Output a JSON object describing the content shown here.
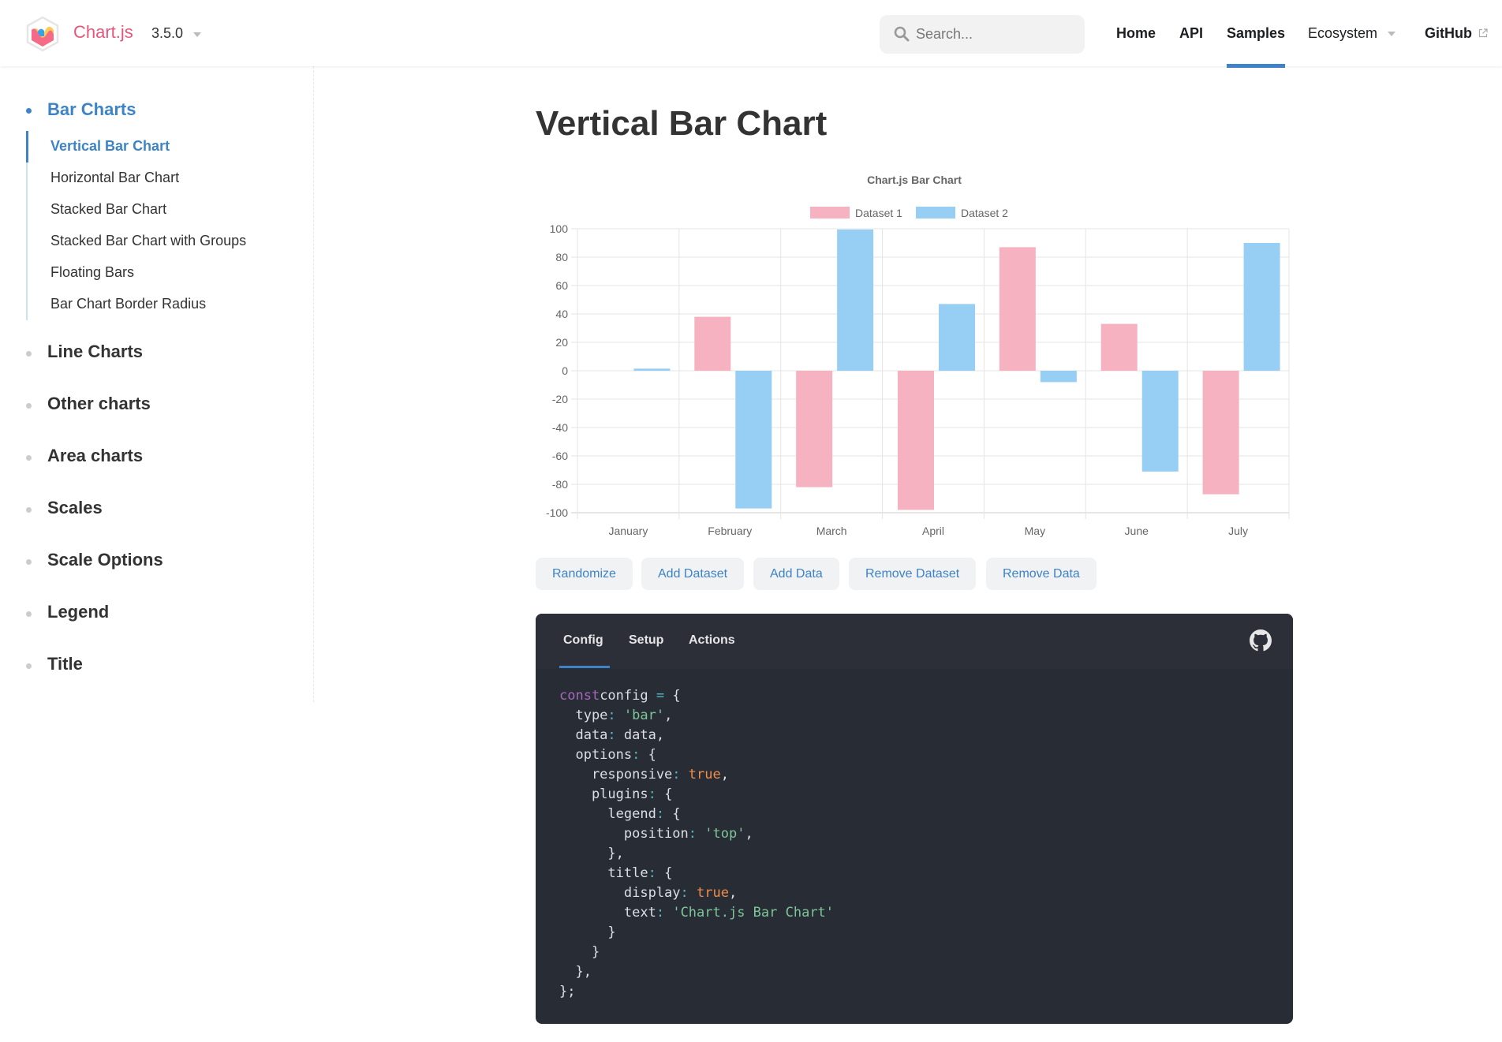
{
  "navbar": {
    "brand": "Chart.js",
    "version": "3.5.0",
    "search_placeholder": "Search...",
    "links": [
      "Home",
      "API",
      "Samples",
      "Ecosystem",
      "GitHub"
    ],
    "active_link": "Samples"
  },
  "sidebar": {
    "sections": [
      {
        "label": "Bar Charts",
        "active": true,
        "items": [
          {
            "label": "Vertical Bar Chart",
            "active": true
          },
          {
            "label": "Horizontal Bar Chart"
          },
          {
            "label": "Stacked Bar Chart"
          },
          {
            "label": "Stacked Bar Chart with Groups"
          },
          {
            "label": "Floating Bars"
          },
          {
            "label": "Bar Chart Border Radius"
          }
        ]
      },
      {
        "label": "Line Charts"
      },
      {
        "label": "Other charts"
      },
      {
        "label": "Area charts"
      },
      {
        "label": "Scales"
      },
      {
        "label": "Scale Options"
      },
      {
        "label": "Legend"
      },
      {
        "label": "Title"
      }
    ]
  },
  "main": {
    "title": "Vertical Bar Chart",
    "buttons": [
      "Randomize",
      "Add Dataset",
      "Add Data",
      "Remove Dataset",
      "Remove Data"
    ],
    "code_tabs": [
      "Config",
      "Setup",
      "Actions"
    ],
    "active_code_tab": "Config",
    "code_lines": [
      [
        [
          "kw",
          "const"
        ],
        [
          "",
          "config "
        ],
        [
          "op",
          "="
        ],
        [
          "",
          " {"
        ]
      ],
      [
        [
          "",
          "  type"
        ],
        [
          "op",
          ":"
        ],
        [
          "",
          " "
        ],
        [
          "str",
          "'bar'"
        ],
        [
          "",
          ","
        ]
      ],
      [
        [
          "",
          "  data"
        ],
        [
          "op",
          ":"
        ],
        [
          "",
          " data,"
        ]
      ],
      [
        [
          "",
          "  options"
        ],
        [
          "op",
          ":"
        ],
        [
          "",
          " {"
        ]
      ],
      [
        [
          "",
          "    responsive"
        ],
        [
          "op",
          ":"
        ],
        [
          "",
          " "
        ],
        [
          "bool",
          "true"
        ],
        [
          "",
          ","
        ]
      ],
      [
        [
          "",
          "    plugins"
        ],
        [
          "op",
          ":"
        ],
        [
          "",
          " {"
        ]
      ],
      [
        [
          "",
          "      legend"
        ],
        [
          "op",
          ":"
        ],
        [
          "",
          " {"
        ]
      ],
      [
        [
          "",
          "        position"
        ],
        [
          "op",
          ":"
        ],
        [
          "",
          " "
        ],
        [
          "str",
          "'top'"
        ],
        [
          "",
          ","
        ]
      ],
      [
        [
          "",
          "      },"
        ]
      ],
      [
        [
          "",
          "      title"
        ],
        [
          "op",
          ":"
        ],
        [
          "",
          " {"
        ]
      ],
      [
        [
          "",
          "        display"
        ],
        [
          "op",
          ":"
        ],
        [
          "",
          " "
        ],
        [
          "bool",
          "true"
        ],
        [
          "",
          ","
        ]
      ],
      [
        [
          "",
          "        text"
        ],
        [
          "op",
          ":"
        ],
        [
          "",
          " "
        ],
        [
          "str",
          "'Chart.js Bar Chart'"
        ]
      ],
      [
        [
          "",
          "      }"
        ]
      ],
      [
        [
          "",
          "    }"
        ]
      ],
      [
        [
          "",
          "  },"
        ]
      ],
      [
        [
          "",
          "};"
        ]
      ]
    ]
  },
  "colors": {
    "accent": "#3d83c6",
    "brand": "#e5577a",
    "dataset1": "#f7b2c2",
    "dataset2": "#96cff3"
  },
  "chart_data": {
    "type": "bar",
    "title": "Chart.js Bar Chart",
    "legend_position": "top",
    "categories": [
      "January",
      "February",
      "March",
      "April",
      "May",
      "June",
      "July"
    ],
    "series": [
      {
        "name": "Dataset 1",
        "color": "#f7b2c2",
        "values": [
          0,
          38,
          -82,
          -98,
          87,
          33,
          -87
        ]
      },
      {
        "name": "Dataset 2",
        "color": "#96cff3",
        "values": [
          1.5,
          -97,
          99.5,
          47,
          -8,
          -71,
          90
        ]
      }
    ],
    "yticks": [
      100,
      80,
      60,
      40,
      20,
      0,
      -20,
      -40,
      -60,
      -80,
      -100
    ],
    "ylim": [
      -100,
      100
    ],
    "xlabel": "",
    "ylabel": "",
    "grid": true
  }
}
